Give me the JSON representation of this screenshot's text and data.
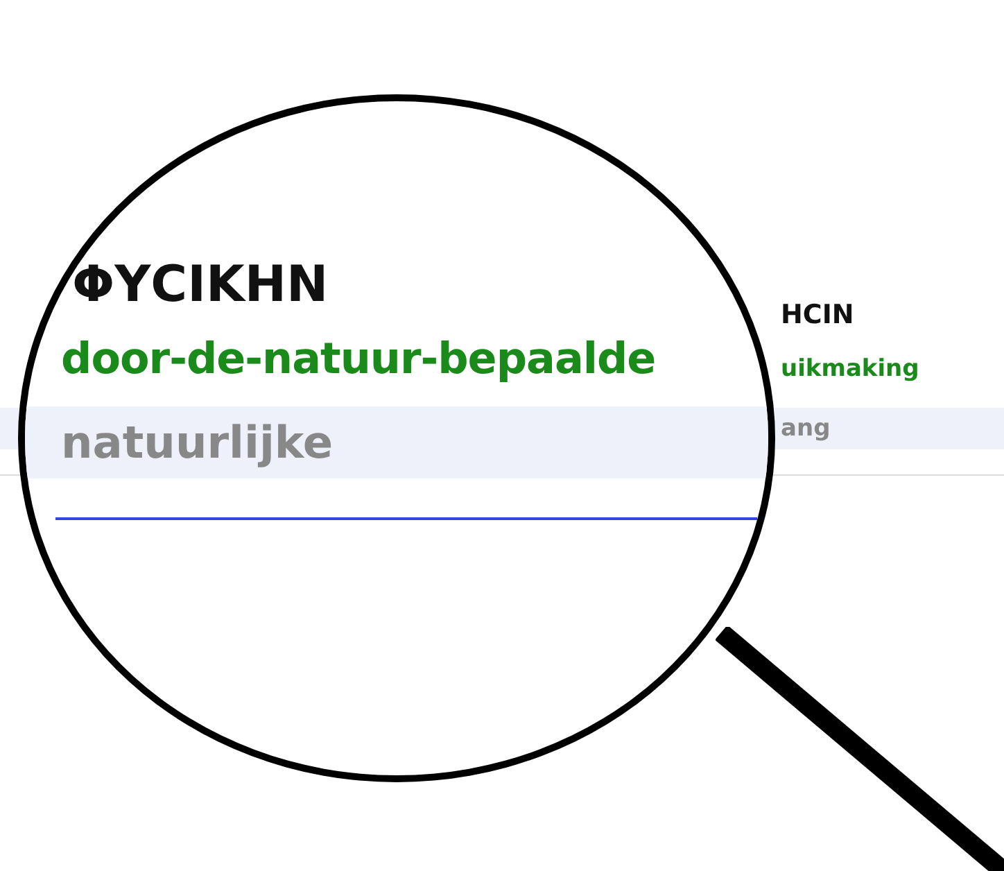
{
  "page": {
    "heading": "HCIN",
    "subheading": "uikmaking",
    "row": "ang"
  },
  "magnifier": {
    "heading": "ΦΥCIKHN",
    "subheading": "door-de-natuur-bepaalde",
    "row": "natuurlijke"
  }
}
